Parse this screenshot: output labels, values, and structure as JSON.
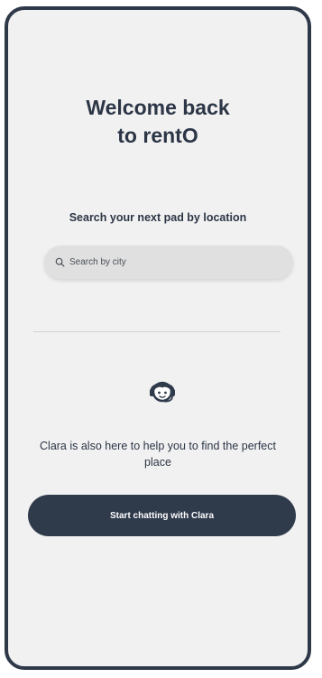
{
  "welcome": {
    "title_line1": "Welcome back",
    "title_line2": "to rentO"
  },
  "search": {
    "label": "Search your next pad by location",
    "placeholder": "Search by city",
    "icon": "search-icon"
  },
  "assistant": {
    "icon": "support-agent-icon",
    "message": "Clara is also here to help you to find the perfect place",
    "button_label": "Start chatting with Clara"
  },
  "colors": {
    "primary": "#2f3a4b",
    "background": "#f1f1f1",
    "input_bg": "#e0e0e0",
    "text": "#2c3646"
  }
}
